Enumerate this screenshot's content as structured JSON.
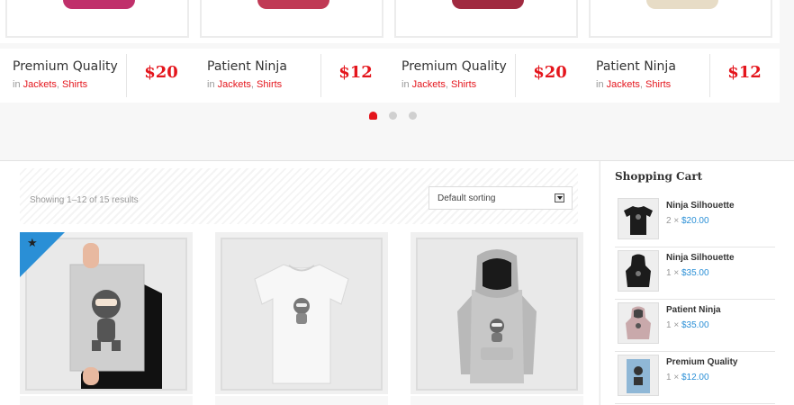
{
  "carousel": {
    "cards": [
      {
        "name": "Premium Quality",
        "in": "in",
        "cat1": "Jackets",
        "sep": ",",
        "cat2": "Shirts",
        "price": "$20",
        "color": "#c0306b"
      },
      {
        "name": "Patient Ninja",
        "in": "in",
        "cat1": "Jackets",
        "sep": ",",
        "cat2": "Shirts",
        "price": "$12",
        "color": "#c03a55"
      },
      {
        "name": "Premium Quality",
        "in": "in",
        "cat1": "Jackets",
        "sep": ",",
        "cat2": "Shirts",
        "price": "$20",
        "color": "#a02a40"
      },
      {
        "name": "Patient Ninja",
        "in": "in",
        "cat1": "Jackets",
        "sep": ",",
        "cat2": "Shirts",
        "price": "$12",
        "color": "#e7dcc6"
      }
    ],
    "pagination": {
      "current": 1,
      "total": 3
    }
  },
  "shop": {
    "result_count": "Showing 1–12 of 15 results",
    "sorting": "Default sorting",
    "products": [
      {
        "image": "ninja-poster",
        "featured": true
      },
      {
        "image": "ninja-tshirt",
        "featured": false
      },
      {
        "image": "ninja-hoodie",
        "featured": false
      }
    ]
  },
  "cart": {
    "title": "Shopping Cart",
    "items": [
      {
        "name": "Ninja Silhouette",
        "qty": "2 ×",
        "price": "$20.00",
        "thumb": "black-tshirt"
      },
      {
        "name": "Ninja Silhouette",
        "qty": "1 ×",
        "price": "$35.00",
        "thumb": "black-hoodie"
      },
      {
        "name": "Patient Ninja",
        "qty": "1 ×",
        "price": "$35.00",
        "thumb": "pink-hoodie"
      },
      {
        "name": "Premium Quality",
        "qty": "1 ×",
        "price": "$12.00",
        "thumb": "blue-poster"
      }
    ]
  },
  "colors": {
    "accent": "#e4151c",
    "link_blue": "#2a8fd6"
  }
}
